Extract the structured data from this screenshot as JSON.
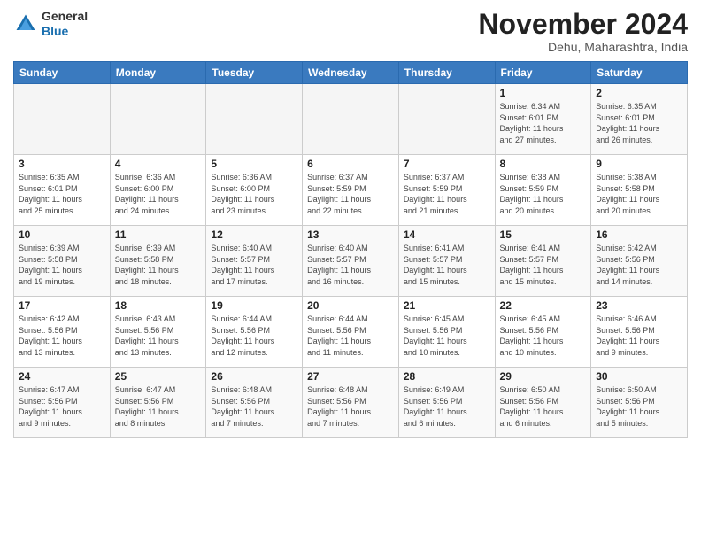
{
  "logo": {
    "general": "General",
    "blue": "Blue"
  },
  "header": {
    "title": "November 2024",
    "location": "Dehu, Maharashtra, India"
  },
  "weekdays": [
    "Sunday",
    "Monday",
    "Tuesday",
    "Wednesday",
    "Thursday",
    "Friday",
    "Saturday"
  ],
  "weeks": [
    [
      {
        "day": "",
        "info": ""
      },
      {
        "day": "",
        "info": ""
      },
      {
        "day": "",
        "info": ""
      },
      {
        "day": "",
        "info": ""
      },
      {
        "day": "",
        "info": ""
      },
      {
        "day": "1",
        "info": "Sunrise: 6:34 AM\nSunset: 6:01 PM\nDaylight: 11 hours\nand 27 minutes."
      },
      {
        "day": "2",
        "info": "Sunrise: 6:35 AM\nSunset: 6:01 PM\nDaylight: 11 hours\nand 26 minutes."
      }
    ],
    [
      {
        "day": "3",
        "info": "Sunrise: 6:35 AM\nSunset: 6:01 PM\nDaylight: 11 hours\nand 25 minutes."
      },
      {
        "day": "4",
        "info": "Sunrise: 6:36 AM\nSunset: 6:00 PM\nDaylight: 11 hours\nand 24 minutes."
      },
      {
        "day": "5",
        "info": "Sunrise: 6:36 AM\nSunset: 6:00 PM\nDaylight: 11 hours\nand 23 minutes."
      },
      {
        "day": "6",
        "info": "Sunrise: 6:37 AM\nSunset: 5:59 PM\nDaylight: 11 hours\nand 22 minutes."
      },
      {
        "day": "7",
        "info": "Sunrise: 6:37 AM\nSunset: 5:59 PM\nDaylight: 11 hours\nand 21 minutes."
      },
      {
        "day": "8",
        "info": "Sunrise: 6:38 AM\nSunset: 5:59 PM\nDaylight: 11 hours\nand 20 minutes."
      },
      {
        "day": "9",
        "info": "Sunrise: 6:38 AM\nSunset: 5:58 PM\nDaylight: 11 hours\nand 20 minutes."
      }
    ],
    [
      {
        "day": "10",
        "info": "Sunrise: 6:39 AM\nSunset: 5:58 PM\nDaylight: 11 hours\nand 19 minutes."
      },
      {
        "day": "11",
        "info": "Sunrise: 6:39 AM\nSunset: 5:58 PM\nDaylight: 11 hours\nand 18 minutes."
      },
      {
        "day": "12",
        "info": "Sunrise: 6:40 AM\nSunset: 5:57 PM\nDaylight: 11 hours\nand 17 minutes."
      },
      {
        "day": "13",
        "info": "Sunrise: 6:40 AM\nSunset: 5:57 PM\nDaylight: 11 hours\nand 16 minutes."
      },
      {
        "day": "14",
        "info": "Sunrise: 6:41 AM\nSunset: 5:57 PM\nDaylight: 11 hours\nand 15 minutes."
      },
      {
        "day": "15",
        "info": "Sunrise: 6:41 AM\nSunset: 5:57 PM\nDaylight: 11 hours\nand 15 minutes."
      },
      {
        "day": "16",
        "info": "Sunrise: 6:42 AM\nSunset: 5:56 PM\nDaylight: 11 hours\nand 14 minutes."
      }
    ],
    [
      {
        "day": "17",
        "info": "Sunrise: 6:42 AM\nSunset: 5:56 PM\nDaylight: 11 hours\nand 13 minutes."
      },
      {
        "day": "18",
        "info": "Sunrise: 6:43 AM\nSunset: 5:56 PM\nDaylight: 11 hours\nand 13 minutes."
      },
      {
        "day": "19",
        "info": "Sunrise: 6:44 AM\nSunset: 5:56 PM\nDaylight: 11 hours\nand 12 minutes."
      },
      {
        "day": "20",
        "info": "Sunrise: 6:44 AM\nSunset: 5:56 PM\nDaylight: 11 hours\nand 11 minutes."
      },
      {
        "day": "21",
        "info": "Sunrise: 6:45 AM\nSunset: 5:56 PM\nDaylight: 11 hours\nand 10 minutes."
      },
      {
        "day": "22",
        "info": "Sunrise: 6:45 AM\nSunset: 5:56 PM\nDaylight: 11 hours\nand 10 minutes."
      },
      {
        "day": "23",
        "info": "Sunrise: 6:46 AM\nSunset: 5:56 PM\nDaylight: 11 hours\nand 9 minutes."
      }
    ],
    [
      {
        "day": "24",
        "info": "Sunrise: 6:47 AM\nSunset: 5:56 PM\nDaylight: 11 hours\nand 9 minutes."
      },
      {
        "day": "25",
        "info": "Sunrise: 6:47 AM\nSunset: 5:56 PM\nDaylight: 11 hours\nand 8 minutes."
      },
      {
        "day": "26",
        "info": "Sunrise: 6:48 AM\nSunset: 5:56 PM\nDaylight: 11 hours\nand 7 minutes."
      },
      {
        "day": "27",
        "info": "Sunrise: 6:48 AM\nSunset: 5:56 PM\nDaylight: 11 hours\nand 7 minutes."
      },
      {
        "day": "28",
        "info": "Sunrise: 6:49 AM\nSunset: 5:56 PM\nDaylight: 11 hours\nand 6 minutes."
      },
      {
        "day": "29",
        "info": "Sunrise: 6:50 AM\nSunset: 5:56 PM\nDaylight: 11 hours\nand 6 minutes."
      },
      {
        "day": "30",
        "info": "Sunrise: 6:50 AM\nSunset: 5:56 PM\nDaylight: 11 hours\nand 5 minutes."
      }
    ]
  ]
}
